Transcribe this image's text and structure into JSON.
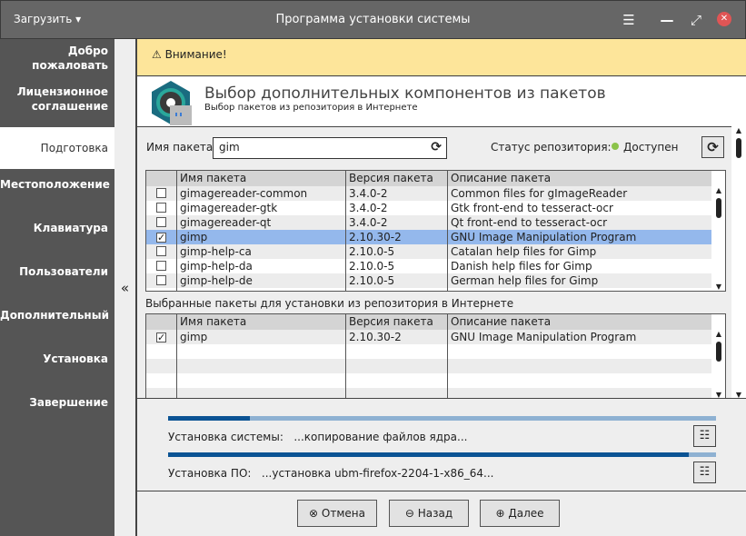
{
  "titlebar": {
    "title": "Программа установки системы",
    "load_menu": "Загрузить ▾"
  },
  "sidebar": {
    "items": [
      "Добро пожаловать",
      "Лицензионное соглашение",
      "Подготовка",
      "Местоположение",
      "Клавиатура",
      "Пользователи",
      "Дополнительный",
      "Установка",
      "Завершение"
    ],
    "active": 2,
    "collapse": "«"
  },
  "warning": {
    "text": "Внимание!"
  },
  "header": {
    "title": "Выбор дополнительных компонентов из пакетов",
    "subtitle": "Выбор пакетов из репозитория в Интернете"
  },
  "search": {
    "label": "Имя пакета:",
    "value": "gim"
  },
  "repo": {
    "label": "Статус репозитория:",
    "status": "Доступен",
    "status_color": "#8bc34a"
  },
  "table_columns": [
    "Имя пакета",
    "Версия пакета",
    "Описание пакета"
  ],
  "packages": [
    {
      "checked": false,
      "name": "gimagereader-common",
      "version": "3.4.0-2",
      "desc": "Common files for gImageReader"
    },
    {
      "checked": false,
      "name": "gimagereader-gtk",
      "version": "3.4.0-2",
      "desc": "Gtk front-end to tesseract-ocr"
    },
    {
      "checked": false,
      "name": "gimagereader-qt",
      "version": "3.4.0-2",
      "desc": "Qt front-end to tesseract-ocr"
    },
    {
      "checked": true,
      "name": "gimp",
      "version": "2.10.30-2",
      "desc": "GNU Image Manipulation Program",
      "selected": true
    },
    {
      "checked": false,
      "name": "gimp-help-ca",
      "version": "2.10.0-5",
      "desc": "Catalan help files for Gimp"
    },
    {
      "checked": false,
      "name": "gimp-help-da",
      "version": "2.10.0-5",
      "desc": "Danish help files for Gimp"
    },
    {
      "checked": false,
      "name": "gimp-help-de",
      "version": "2.10.0-5",
      "desc": "German help files for Gimp"
    }
  ],
  "selected_label": "Выбранные пакеты для установки из репозитория в Интернете",
  "selected_packages": [
    {
      "checked": true,
      "name": "gimp",
      "version": "2.10.30-2",
      "desc": "GNU Image Manipulation Program"
    }
  ],
  "progress": [
    {
      "label": "Установка системы:",
      "status": "...копирование файлов ядра...",
      "percent": 15
    },
    {
      "label": "Установка ПО:",
      "status": "...установка ubm-firefox-2204-1-x86_64...",
      "percent": 95
    }
  ],
  "buttons": {
    "cancel": "Отмена",
    "back": "Назад",
    "next": "Далее"
  }
}
